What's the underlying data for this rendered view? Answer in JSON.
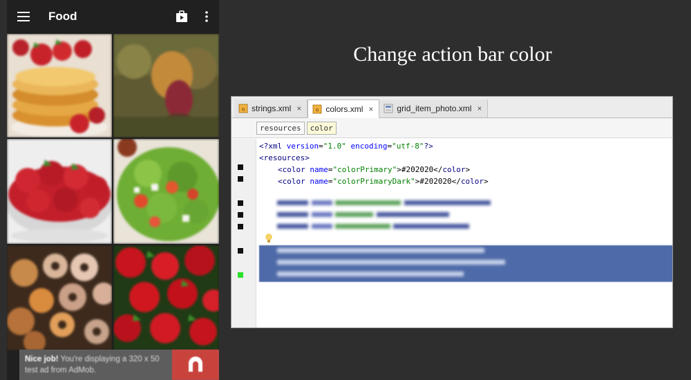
{
  "app": {
    "title": "Food"
  },
  "ad": {
    "bold": "Nice job!",
    "text": " You're displaying a 320 x 50 test ad from AdMob."
  },
  "heading": "Change action bar color",
  "ide": {
    "tabs": [
      {
        "label": "strings.xml",
        "close": "×"
      },
      {
        "label": "colors.xml",
        "close": "×"
      },
      {
        "label": "grid_item_photo.xml",
        "close": "×"
      }
    ],
    "breadcrumbs": [
      "resources",
      "color"
    ],
    "code": {
      "l1_pre": "<?xml ",
      "l1_a1": "version",
      "l1_eq1": "=",
      "l1_v1": "\"1.0\"",
      "l1_sp": " ",
      "l1_a2": "encoding",
      "l1_eq2": "=",
      "l1_v2": "\"utf-8\"",
      "l1_post": "?>",
      "l2": "<resources>",
      "l3_open": "<color ",
      "l3_attr": "name",
      "l3_eq": "=",
      "l3_val": "\"colorPrimary\"",
      "l3_mid": ">#202020</",
      "l3_close": "color",
      "l3_end": ">",
      "l4_open": "<color ",
      "l4_attr": "name",
      "l4_eq": "=",
      "l4_val": "\"colorPrimaryDark\"",
      "l4_mid": ">#202020</",
      "l4_close": "color",
      "l4_end": ">"
    }
  }
}
